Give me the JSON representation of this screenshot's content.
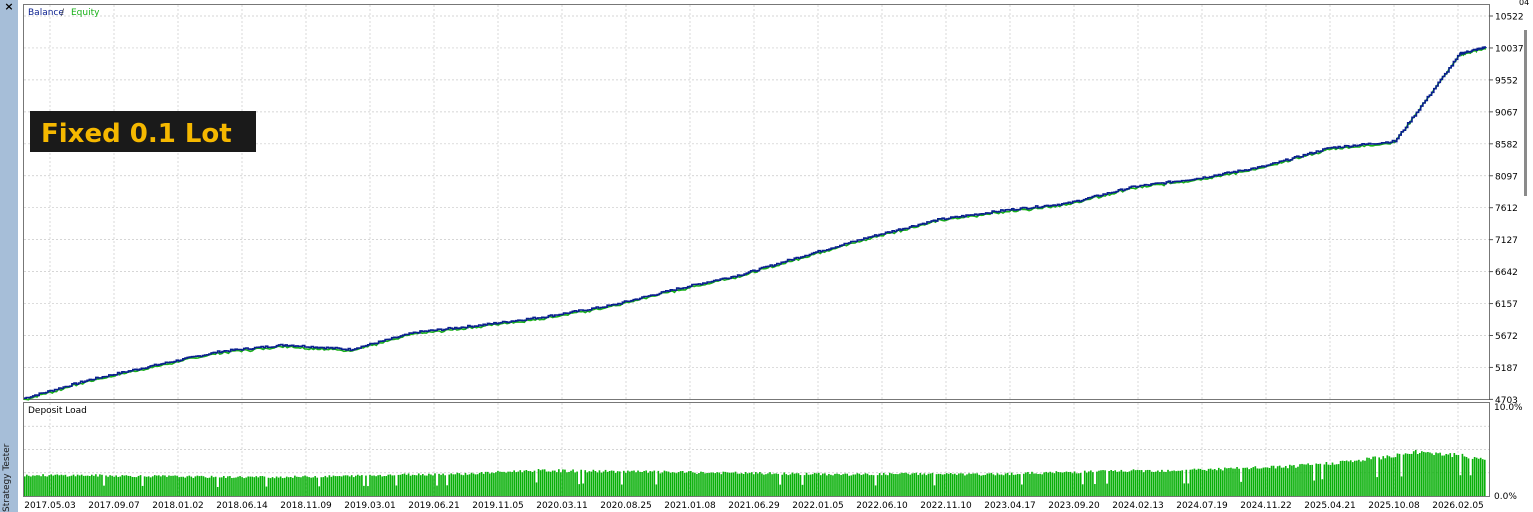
{
  "window": {
    "side_label": "Strategy Tester",
    "close_symbol": "×"
  },
  "overlay": {
    "text": "Fixed 0.1 Lot"
  },
  "colors": {
    "balance": "#0a1f8f",
    "equity": "#18b018",
    "deposit_load": "#08b008",
    "grid": "#c8c8c8",
    "overlay_bg": "#1a1a1a",
    "overlay_text": "#f5b800"
  },
  "chart_data": [
    {
      "type": "line",
      "legend": [
        "Balance",
        "Equity"
      ],
      "legend_separator": " / ",
      "y_ticks": [
        "10522",
        "10037",
        "9552",
        "9067",
        "8582",
        "8097",
        "7612",
        "7127",
        "6642",
        "6157",
        "5672",
        "5187",
        "4703"
      ],
      "y_tick_values": [
        10522,
        10037,
        9552,
        9067,
        8582,
        8097,
        7612,
        7127,
        6642,
        6157,
        5672,
        5187,
        4703
      ],
      "top_right_label": "04",
      "ylim": [
        4703,
        10600
      ],
      "x_ticks": [
        "2017.05.03",
        "2017.09.07",
        "2018.01.02",
        "2018.06.14",
        "2018.11.09",
        "2019.03.01",
        "2019.06.21",
        "2019.11.05",
        "2020.03.11",
        "2020.08.25",
        "2021.01.08",
        "2021.06.29",
        "2022.01.05",
        "2022.06.10",
        "2022.11.10",
        "2023.04.17",
        "2023.09.20",
        "2024.02.13",
        "2024.07.19",
        "2024.11.22",
        "2025.04.21",
        "2025.10.08",
        "2026.02.05"
      ],
      "grid": true,
      "series": [
        {
          "name": "Balance",
          "x": [
            0,
            1,
            2,
            3,
            4,
            5,
            6,
            7,
            8,
            9,
            10,
            11,
            12,
            13,
            14,
            15,
            16,
            17,
            18,
            19,
            20,
            21,
            22,
            22.4
          ],
          "values": [
            4720,
            5000,
            5220,
            5430,
            5530,
            5460,
            5720,
            5830,
            5960,
            6130,
            6380,
            6600,
            6900,
            7180,
            7430,
            7570,
            7680,
            7930,
            8060,
            8240,
            8520,
            8620,
            9950,
            10050
          ]
        }
      ]
    },
    {
      "type": "bar",
      "title": "Deposit Load",
      "y_ticks": [
        "10.0%",
        "0.0%"
      ],
      "ylim": [
        0,
        10
      ],
      "profile": [
        [
          0,
          2.5
        ],
        [
          1,
          2.5
        ],
        [
          2,
          2.4
        ],
        [
          3,
          2.3
        ],
        [
          4,
          2.3
        ],
        [
          5,
          2.4
        ],
        [
          6,
          2.6
        ],
        [
          7,
          2.7
        ],
        [
          8,
          3.1
        ],
        [
          9,
          3.0
        ],
        [
          10,
          2.9
        ],
        [
          11,
          2.8
        ],
        [
          12,
          2.7
        ],
        [
          13,
          2.6
        ],
        [
          14,
          2.7
        ],
        [
          15,
          2.6
        ],
        [
          16,
          2.8
        ],
        [
          17,
          3.0
        ],
        [
          18,
          3.1
        ],
        [
          19,
          3.3
        ],
        [
          20,
          3.6
        ],
        [
          21,
          4.3
        ],
        [
          22,
          5.4
        ],
        [
          23,
          4.5
        ]
      ],
      "bar_count": 720
    }
  ]
}
